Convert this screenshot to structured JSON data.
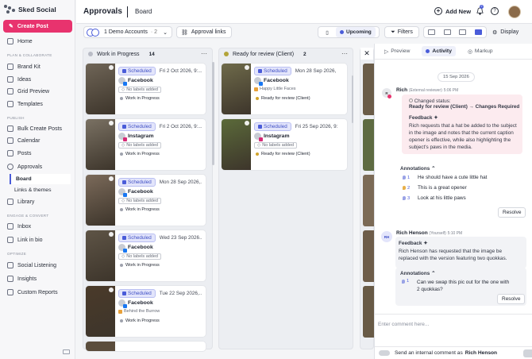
{
  "sidebar": {
    "brand": "Sked Social",
    "create_post": "Create Post",
    "home": "Home",
    "section_plan": "PLAN & COLLABORATE",
    "brand_kit": "Brand Kit",
    "ideas": "Ideas",
    "grid_preview": "Grid Preview",
    "templates": "Templates",
    "section_publish": "PUBLISH",
    "bulk_create": "Bulk Create Posts",
    "calendar": "Calendar",
    "posts": "Posts",
    "approvals": "Approvals",
    "board": "Board",
    "links_themes": "Links & themes",
    "library": "Library",
    "section_engage": "ENGAGE & CONVERT",
    "inbox": "Inbox",
    "link_in_bio": "Link in bio",
    "section_optimize": "OPTIMIZE",
    "social_listening": "Social Listening",
    "insights": "Insights",
    "custom_reports": "Custom Reports"
  },
  "header": {
    "title": "Approvals",
    "subtitle": "Board",
    "add_new": "Add New",
    "notif_count": "2"
  },
  "toolbar": {
    "accounts": "1 Demo Accounts",
    "accounts_count": "· 2",
    "approval_links": "Approval links",
    "view_upcoming": "Upcoming",
    "filters": "Filters",
    "display": "Display"
  },
  "columns": [
    {
      "title": "Work in Progress",
      "count": "14",
      "dot_color": "#b9bcc6",
      "cards": [
        {
          "badge": "Scheduled",
          "date": "Fri 2 Oct 2026, 9:...",
          "platform": "Facebook",
          "label": "No labels added",
          "status": "Work in Progress",
          "status_color": "#9ea2ad",
          "plat_color": "#1877f2",
          "thumb": "#6f6557"
        },
        {
          "badge": "Scheduled",
          "date": "Fri 2 Oct 2026, 9:...",
          "platform": "Instagram",
          "label": "No labels added",
          "status": "Work in Progress",
          "status_color": "#9ea2ad",
          "plat_color": "#d62976",
          "thumb": "#7a7163"
        },
        {
          "badge": "Scheduled",
          "date": "Mon 28 Sep 2026,...",
          "platform": "Facebook",
          "label": "No labels added",
          "status": "Work in Progress",
          "status_color": "#9ea2ad",
          "plat_color": "#1877f2",
          "thumb": "#7b6a5a"
        },
        {
          "badge": "Scheduled",
          "date": "Wed 23 Sep 2026...",
          "platform": "Facebook",
          "label": "No labels added",
          "status": "Work in Progress",
          "status_color": "#9ea2ad",
          "plat_color": "#1877f2",
          "thumb": "#5e5446"
        },
        {
          "badge": "Scheduled",
          "date": "Tue 22 Sep 2026,...",
          "platform": "Facebook",
          "label": "Behind the Burrow",
          "status": "Work in Progress",
          "status_color": "#9ea2ad",
          "plat_color": "#1877f2",
          "thumb": "#4a3a2a"
        }
      ]
    },
    {
      "title": "Ready for review (Client)",
      "count": "2",
      "dot_color": "#b3a43a",
      "cards": [
        {
          "badge": "Scheduled",
          "date": "Mon 28 Sep 2026, 9:...",
          "platform": "Facebook",
          "label": "Happy Little Faces",
          "status": "Ready for review (Client)",
          "status_color": "#d1a42c",
          "plat_color": "#1877f2",
          "thumb": "#6e6a4a"
        },
        {
          "badge": "Scheduled",
          "date": "Fri 25 Sep 2026, 9:0...",
          "platform": "Instagram",
          "label": "No labels added",
          "status": "Ready for review (Client)",
          "status_color": "#d1a42c",
          "plat_color": "#d62976",
          "thumb": "#5b6a3a"
        }
      ]
    }
  ],
  "panel": {
    "tabs": [
      "Preview",
      "Activity",
      "Markup"
    ],
    "date": "15 Sep 2026",
    "msg1": {
      "initial": "R",
      "name": "Rich",
      "role": "(External reviewer)",
      "time": "5:06 PM",
      "changed_status": "Changed status:",
      "status_from": "Ready for review (Client)",
      "arrow": "→",
      "status_to": "Changes Required",
      "feedback": "Feedback",
      "text": "Rich requests that a hat be added to the subject in the image and notes that the current caption opener is effective, while also highlighting the subject's paws in the media.",
      "annotations": "Annotations",
      "ann": [
        {
          "n": "1",
          "text": "He should have a cute little hat"
        },
        {
          "n": "2",
          "text": "This is a great opener"
        },
        {
          "n": "3",
          "text": "Look at his little paws"
        }
      ],
      "resolve": "Resolve"
    },
    "msg2": {
      "initial": "RH",
      "name": "Rich Henson",
      "role": "(Yourself)",
      "time": "5:10 PM",
      "feedback": "Feedback",
      "text": "Rich Henson has requested that the image be replaced with the version featuring two quokkas.",
      "annotations": "Annotations",
      "ann": [
        {
          "n": "1",
          "text": "Can we swap this pic out for the one with 2 quokkas?"
        }
      ],
      "resolve": "Resolve"
    },
    "comment_placeholder": "Enter comment here...",
    "internal_prefix": "Send an internal comment as",
    "internal_name": "Rich Henson"
  }
}
